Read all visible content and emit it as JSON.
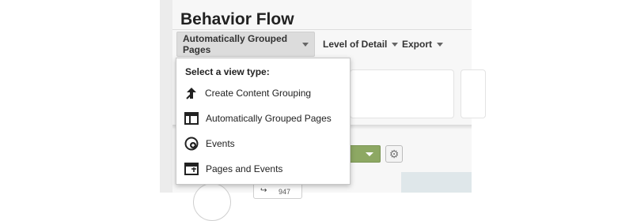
{
  "page": {
    "title": "Behavior Flow"
  },
  "toolbar": {
    "grouping_label": "Automatically Grouped Pages",
    "detail_label": "Level of Detail",
    "export_label": "Export"
  },
  "view_menu": {
    "heading": "Select a view type:",
    "items": [
      {
        "label": "Create Content Grouping",
        "icon": "content-grouping-icon"
      },
      {
        "label": "Automatically Grouped Pages",
        "icon": "grouped-pages-icon"
      },
      {
        "label": "Events",
        "icon": "events-icon"
      },
      {
        "label": "Pages and Events",
        "icon": "pages-and-events-icon"
      }
    ]
  },
  "flow": {
    "node_count": "947"
  },
  "colors": {
    "accent_green": "#8da863",
    "menu_border": "#c8c8c8",
    "active_button": "#dcdcdc"
  }
}
